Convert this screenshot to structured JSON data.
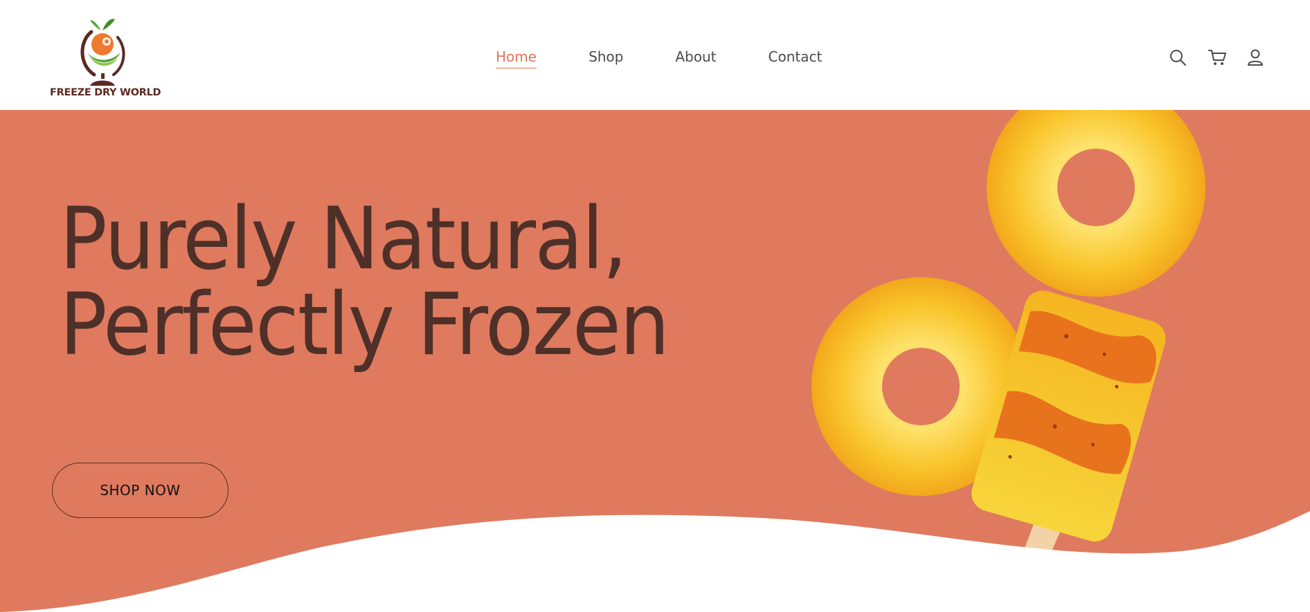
{
  "brand": {
    "name": "FREEZE DRY WORLD",
    "colors": {
      "accent": "#df7459",
      "hero_bg": "#df7a5e",
      "dark_brown": "#4e3029",
      "logo_green": "#5aa83a",
      "logo_orange": "#ef7a2e"
    }
  },
  "nav": {
    "items": [
      {
        "label": "Home",
        "active": true
      },
      {
        "label": "Shop",
        "active": false
      },
      {
        "label": "About",
        "active": false
      },
      {
        "label": "Contact",
        "active": false
      }
    ]
  },
  "header_icons": [
    "search-icon",
    "cart-icon",
    "account-icon"
  ],
  "hero": {
    "headline_line1": "Purely Natural,",
    "headline_line2": "Perfectly Frozen",
    "cta_label": "SHOP NOW"
  }
}
